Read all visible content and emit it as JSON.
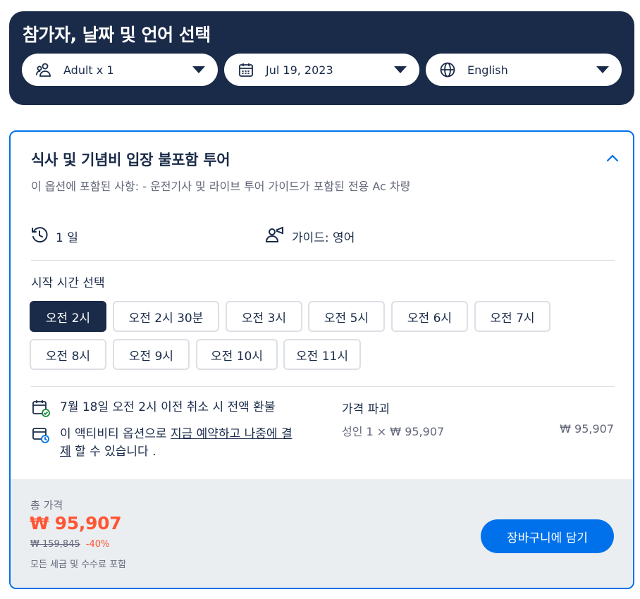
{
  "header": {
    "title": "참가자, 날짜 및 언어 선택",
    "participants": {
      "label": "Adult x 1",
      "icon": "people-icon"
    },
    "date": {
      "label": "Jul 19, 2023",
      "icon": "calendar-icon"
    },
    "language": {
      "label": "English",
      "icon": "globe-icon"
    }
  },
  "option": {
    "title": "식사 및 기념비 입장 불포함 투어",
    "description": "이 옵션에 포함된 사항: - 운전기사 및 라이브 투어 가이드가 포함된 전용 Ac 차량",
    "duration": "1 일",
    "guide": "가이드: 영어",
    "start_time_label": "시작 시간 선택",
    "times": [
      "오전 2시",
      "오전 2시 30분",
      "오전 3시",
      "오전 5시",
      "오전 6시",
      "오전 7시",
      "오전 8시",
      "오전 9시",
      "오전 10시",
      "오전 11시"
    ],
    "selected_time_index": 0,
    "cancellation": "7월 18일 오전 2시 이전 취소 시 전액 환불",
    "pay_later": {
      "prefix": "이 액티비티 옵션으로 ",
      "link": "지금 예약하고 나중에 결제",
      "suffix": " 할 수 있습니다 ."
    },
    "breakdown": {
      "title": "가격 파괴",
      "line": "성인 1 × ₩ 95,907",
      "amount": "₩ 95,907"
    }
  },
  "footer": {
    "total_label": "총 가격",
    "total_price": "₩ 95,907",
    "original_price": "₩ 159,845",
    "discount": "-40%",
    "tax_note": "모든 세금 및 수수료 포함",
    "cart_button": "장바구니에 담기"
  },
  "colors": {
    "navy": "#1a2b49",
    "blue": "#0071eb",
    "price_red": "#ff5533",
    "footer_bg": "#ebeef1"
  }
}
